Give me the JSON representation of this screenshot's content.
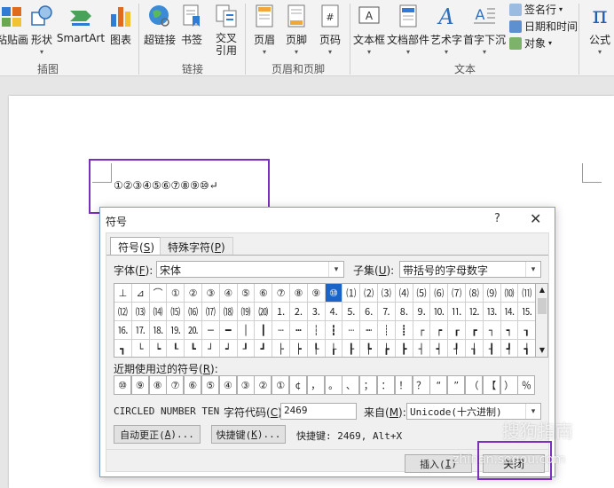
{
  "ribbon": {
    "buttons": [
      {
        "label": "粘贴画"
      },
      {
        "label": "形状"
      },
      {
        "label": "SmartArt"
      },
      {
        "label": "图表"
      },
      {
        "label": "超链接"
      },
      {
        "label": "书签"
      },
      {
        "label": "交叉",
        "label2": "引用"
      },
      {
        "label": "页眉"
      },
      {
        "label": "页脚"
      },
      {
        "label": "页码"
      },
      {
        "label": "文本框"
      },
      {
        "label": "文档部件"
      },
      {
        "label": "艺术字"
      },
      {
        "label": "首字下沉"
      },
      {
        "label": "公式"
      }
    ],
    "small": {
      "signature": "签名行",
      "datetime": "日期和时间",
      "object": "对象"
    },
    "groups": {
      "illustrations": "插图",
      "links": "链接",
      "header_footer": "页眉和页脚",
      "text": "文本"
    },
    "symbol_glyph": "π"
  },
  "document": {
    "text": "①②③④⑤⑥⑦⑧⑨⑩↵"
  },
  "dialog": {
    "title": "符号",
    "help": "?",
    "close_glyph": "✕",
    "tabs": {
      "symbols": {
        "pre": "符号(",
        "key": "S",
        "post": ")"
      },
      "special": {
        "pre": "特殊字符(",
        "key": "P",
        "post": ")"
      }
    },
    "font": {
      "pre": "字体(",
      "key": "F",
      "post": "):",
      "value": "宋体"
    },
    "subset": {
      "pre": "子集(",
      "key": "U",
      "post": "):",
      "value": "带括号的字母数字"
    },
    "grid_rows": [
      [
        "⊥",
        "⊿",
        "⌒",
        "①",
        "②",
        "③",
        "④",
        "⑤",
        "⑥",
        "⑦",
        "⑧",
        "⑨",
        "⑩",
        "⑴",
        "⑵",
        "⑶",
        "⑷",
        "⑸",
        "⑹",
        "⑺",
        "⑻",
        "⑼",
        "⑽",
        "⑾"
      ],
      [
        "⑿",
        "⒀",
        "⒁",
        "⒂",
        "⒃",
        "⒄",
        "⒅",
        "⒆",
        "⒇",
        "⒈",
        "⒉",
        "⒊",
        "⒋",
        "⒌",
        "⒍",
        "⒎",
        "⒏",
        "⒐",
        "⒑",
        "⒒",
        "⒓",
        "⒔",
        "⒕",
        "⒖"
      ],
      [
        "⒗",
        "⒘",
        "⒙",
        "⒚",
        "⒛",
        "─",
        "━",
        "│",
        "┃",
        "┄",
        "┅",
        "┆",
        "┇",
        "┈",
        "┉",
        "┊",
        "┋",
        "┌",
        "┍",
        "┎",
        "┏",
        "┐",
        "┑",
        "┒"
      ],
      [
        "┓",
        "└",
        "┕",
        "┖",
        "┗",
        "┘",
        "┙",
        "┚",
        "┛",
        "├",
        "┝",
        "┞",
        "┟",
        "┠",
        "┡",
        "┢",
        "┣",
        "┤",
        "┥",
        "┦",
        "┧",
        "┨",
        "┩",
        "┪"
      ]
    ],
    "selected_glyph": "⑩",
    "recent_label": {
      "pre": "近期使用过的符号(",
      "key": "R",
      "post": "):"
    },
    "recent": [
      "⑩",
      "⑨",
      "⑧",
      "⑦",
      "⑥",
      "⑤",
      "④",
      "③",
      "②",
      "①",
      "¢",
      "，",
      "。",
      "、",
      "；",
      "：",
      "！",
      "？",
      "“",
      "”",
      "（",
      "【",
      "）",
      "％"
    ],
    "char_name": "CIRCLED NUMBER TEN",
    "code_label": {
      "pre": "字符代码(",
      "key": "C",
      "post": "):"
    },
    "code_value": "2469",
    "from_label": {
      "pre": "来自(",
      "key": "M",
      "post": "):"
    },
    "from_value": "Unicode(十六进制)",
    "autocorrect": {
      "pre": "自动更正(",
      "key": "A",
      "post": ")..."
    },
    "shortcut_btn": {
      "pre": "快捷键(",
      "key": "K",
      "post": ")..."
    },
    "shortcut_text": "快捷键: 2469, Alt+X",
    "insert": {
      "pre": "插入(",
      "key": "I",
      "post": ")"
    },
    "close_btn": "关闭"
  },
  "watermark": {
    "cn": "搜狗指南",
    "url": "zhinan.sogou.com"
  },
  "colors": {
    "highlight": "#7b2fbf",
    "selected": "#1a64c7"
  }
}
